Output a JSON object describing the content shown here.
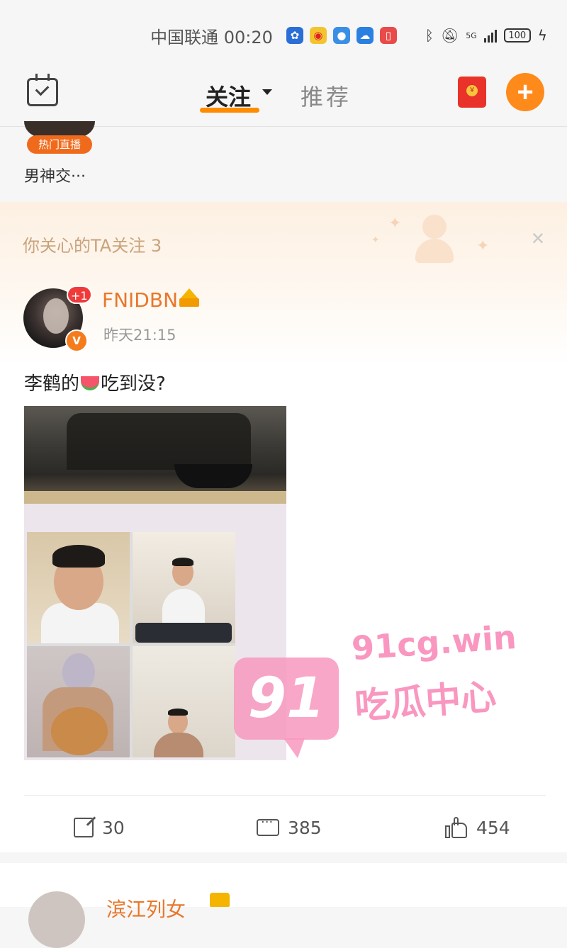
{
  "status_bar": {
    "carrier": "中国联通",
    "time": "00:20",
    "network": "5G",
    "battery": "100"
  },
  "nav": {
    "tab_following": "关注",
    "tab_recommend": "推荐",
    "add_label": "+"
  },
  "prev_card": {
    "live_badge": "热门直播",
    "text": "男神交···"
  },
  "post": {
    "banner": "你关心的TA关注 3",
    "close_label": "×",
    "badge": "+1",
    "verified": "V",
    "username": "FNIDBN",
    "time": "昨天21:15",
    "text_before": "李鹤的",
    "text_after": "吃到没?",
    "shares": "30",
    "comments": "385",
    "likes": "454"
  },
  "watermark": {
    "badge": "91",
    "domain": "91cg.win",
    "name": "吃瓜中心"
  },
  "next_card": {
    "username": "滨江列女"
  },
  "colors": {
    "accent": "#ff8a1c",
    "username": "#e8772a",
    "banner_text": "#c9a37c",
    "watermark": "#f898be"
  }
}
